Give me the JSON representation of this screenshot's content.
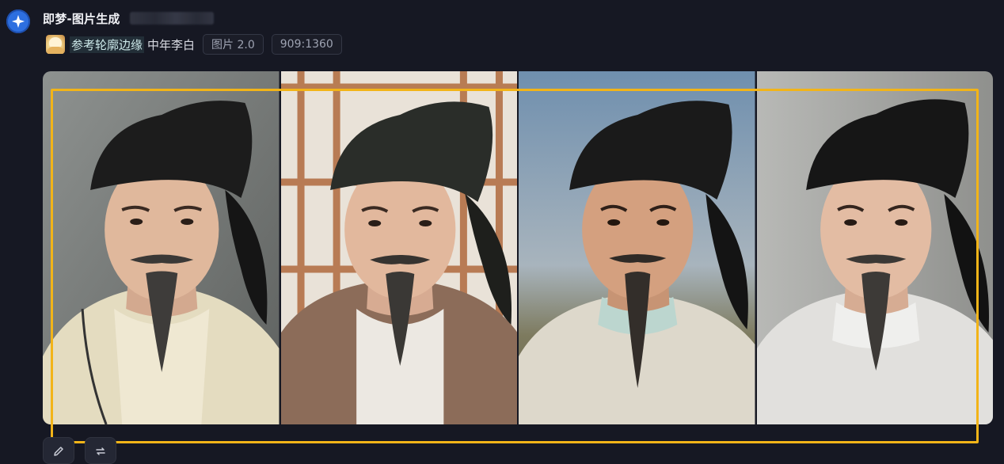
{
  "header": {
    "title": "即梦-图片生成",
    "avatar_icon": "jimeng-star-icon"
  },
  "generation": {
    "reference_label": "参考轮廓边缘",
    "prompt": "中年李白",
    "model_chip": "图片 2.0",
    "ratio_chip": "909:1360"
  },
  "images": [
    {
      "subject": "li-bai-portrait-1"
    },
    {
      "subject": "li-bai-portrait-2"
    },
    {
      "subject": "li-bai-portrait-3"
    },
    {
      "subject": "li-bai-portrait-4"
    }
  ],
  "actions": [
    {
      "icon": "edit-icon"
    },
    {
      "icon": "regenerate-icon"
    }
  ],
  "colors": {
    "background": "#161823",
    "highlight": "#f2b418",
    "accent": "#2d6fe0"
  }
}
